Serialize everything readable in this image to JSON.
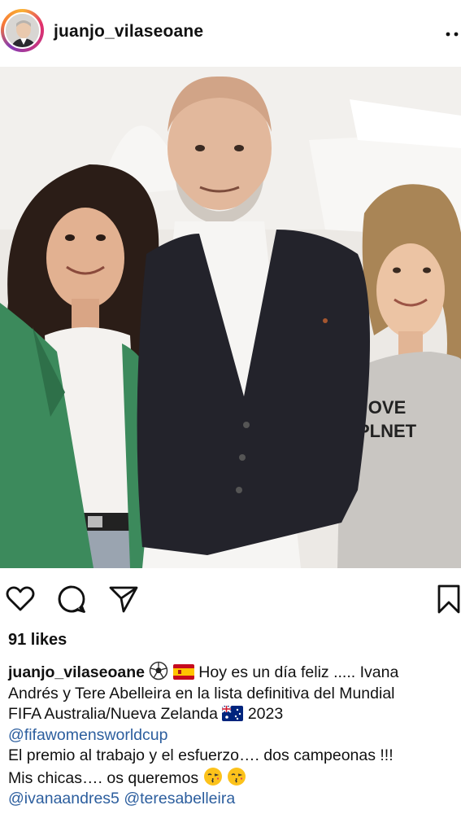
{
  "post": {
    "username": "juanjo_vilaseoane",
    "likes_label": "91 likes"
  },
  "photo": {
    "shirt_text_line1": "E OVE",
    "shirt_text_line2": "R PLNET"
  },
  "caption": {
    "username": "juanjo_vilaseoane",
    "line1_text": "Hoy es un día feliz ..... Ivana",
    "line2": "Andrés y Tere Abelleira en la lista definitiva del Mundial",
    "line3_text": "FIFA Australia/Nueva Zelanda",
    "line3_year": "2023",
    "mention1": "@fifawomensworldcup",
    "line5": "El premio al trabajo y el esfuerzo…. dos campeonas !!!",
    "line6": "Mis chicas…. os queremos",
    "mention2": "@ivanaandres5",
    "mention3": "@teresabelleira"
  },
  "icons": {
    "more": "more-options-icon",
    "like": "heart-icon",
    "comment": "comment-icon",
    "share": "send-icon",
    "save": "bookmark-icon",
    "ball": "soccer-ball-emoji",
    "spain": "spain-flag-emoji",
    "australia": "australia-flag-emoji",
    "kiss": "kissing-face-emoji"
  },
  "colors": {
    "link": "#2c5e9e",
    "text": "#111111",
    "ring_start": "#f9b233",
    "ring_end": "#c13584"
  }
}
